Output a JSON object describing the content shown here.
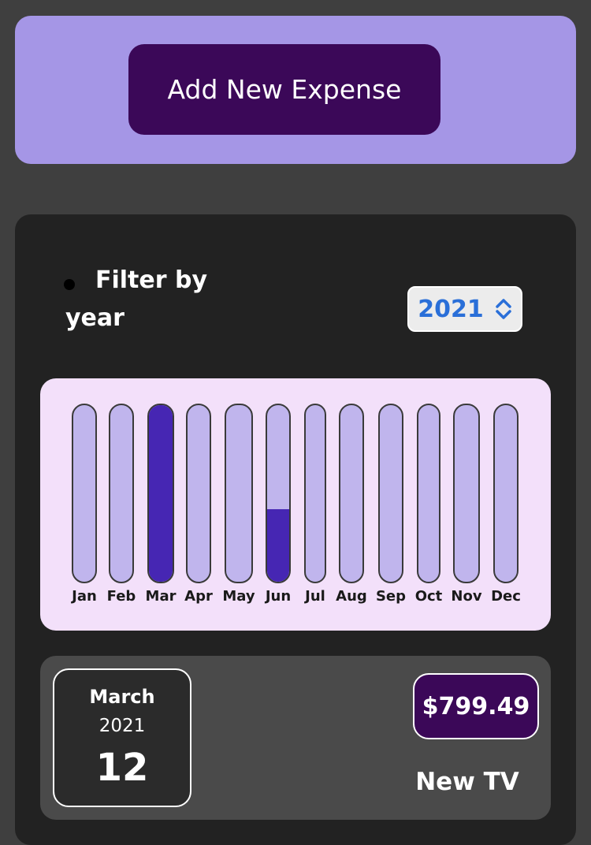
{
  "new_expense": {
    "add_button_label": "Add New Expense"
  },
  "filter": {
    "label_line1": "Filter by",
    "label_line2": "year",
    "selected_year": "2021"
  },
  "chart_data": {
    "type": "bar",
    "categories": [
      "Jan",
      "Feb",
      "Mar",
      "Apr",
      "May",
      "Jun",
      "Jul",
      "Aug",
      "Sep",
      "Oct",
      "Nov",
      "Dec"
    ],
    "values": [
      0,
      0,
      1.0,
      0,
      0,
      0.41,
      0,
      0,
      0,
      0,
      0,
      0
    ],
    "colors": {
      "track": "#c0b5ed",
      "fill": "#4626b3"
    }
  },
  "expense_item": {
    "month": "March",
    "year": "2021",
    "day": "12",
    "amount": "$799.49",
    "title": "New TV"
  },
  "colors": {
    "page_bg": "#3f3f3f",
    "form_bg": "#a596e6",
    "button_bg": "#3b0858",
    "expenses_bg": "#222222",
    "chart_bg": "#f3e0fa",
    "item_bg": "#4a4a4a",
    "select_text": "#2a6fd8"
  },
  "icons": {
    "select_arrow": "chevron-up-down-icon"
  }
}
